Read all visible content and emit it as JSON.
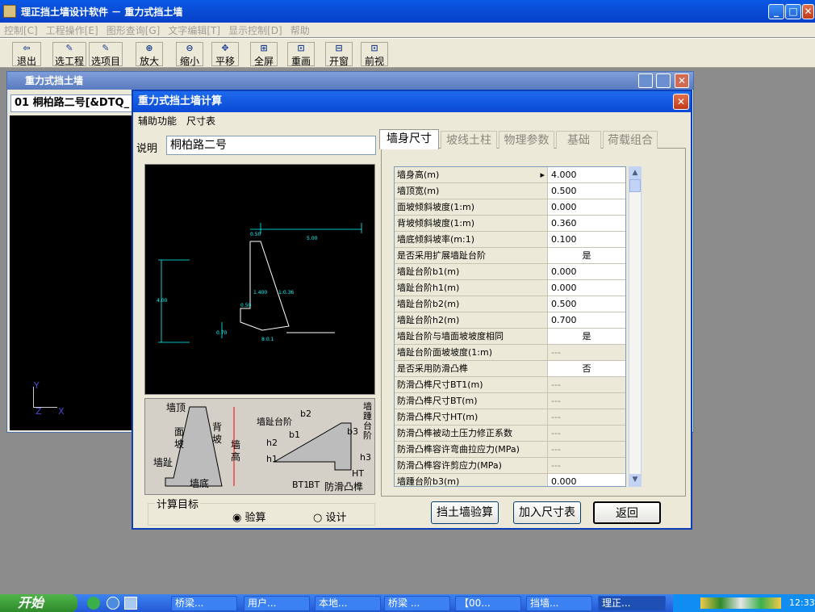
{
  "app": {
    "title": "理正挡土墙设计软件 － 重力式挡土墙",
    "controls": {
      "min": "_",
      "max": "□",
      "close": "✕"
    }
  },
  "menu": [
    "控制[C]",
    "工程操作[E]",
    "图形查询[G]",
    "文字编辑[T]",
    "显示控制[D]",
    "帮助"
  ],
  "toolbar": [
    "退出",
    "选工程",
    "选项目",
    "放大",
    "缩小",
    "平移",
    "全屏",
    "重画",
    "开窗",
    "前视"
  ],
  "inner_window": {
    "title": "重力式挡土墙",
    "combo": "01 桐柏路二号[&DTQ_",
    "axes": {
      "y": "Y",
      "z": "Z",
      "x": "X"
    }
  },
  "dialog": {
    "title": "重力式挡土墙计算",
    "close": "✕",
    "menu": [
      "辅助功能",
      "尺寸表"
    ],
    "desc_label": "说明",
    "desc_value": "桐柏路二号",
    "cad": {
      "dims": [
        "0.50",
        "5.00",
        "4.00",
        "1.400",
        "0.50",
        "0.70",
        "8:0.1",
        "1:0.36"
      ]
    },
    "sketch": {
      "labels": [
        "墙顶",
        "面坡",
        "背坡",
        "墙高",
        "墙趾",
        "墙底",
        "墙趾台阶",
        "b1",
        "b2",
        "h2",
        "h1",
        "BT1",
        "BT",
        "HT",
        "b3",
        "h3",
        "墙踵台阶",
        "防滑凸榫"
      ]
    },
    "target_group": {
      "label": "计算目标",
      "options": [
        "验算",
        "设计"
      ],
      "selected": "验算"
    },
    "tabs": [
      "墙身尺寸",
      "坡线土柱",
      "物理参数",
      "基础",
      "荷载组合"
    ],
    "active_tab": "墙身尺寸",
    "grid": [
      {
        "k": "墙身高(m)",
        "v": "4.000"
      },
      {
        "k": "墙顶宽(m)",
        "v": "0.500"
      },
      {
        "k": "面坡倾斜坡度(1:m)",
        "v": "0.000"
      },
      {
        "k": "背坡倾斜坡度(1:m)",
        "v": "0.360"
      },
      {
        "k": "墙底倾斜坡率(m:1)",
        "v": "0.100"
      },
      {
        "k": "是否采用扩展墙趾台阶",
        "v": "是",
        "c": true
      },
      {
        "k": "墙趾台阶b1(m)",
        "v": "0.000"
      },
      {
        "k": "墙趾台阶h1(m)",
        "v": "0.000"
      },
      {
        "k": "墙趾台阶b2(m)",
        "v": "0.500"
      },
      {
        "k": "墙趾台阶h2(m)",
        "v": "0.700"
      },
      {
        "k": "墙趾台阶与墙面坡坡度相同",
        "v": "是",
        "c": true
      },
      {
        "k": "墙趾台阶面坡坡度(1:m)",
        "v": "---",
        "d": true
      },
      {
        "k": "是否采用防滑凸榫",
        "v": "否",
        "c": true
      },
      {
        "k": "防滑凸榫尺寸BT1(m)",
        "v": "---",
        "d": true
      },
      {
        "k": "防滑凸榫尺寸BT(m)",
        "v": "---",
        "d": true
      },
      {
        "k": "防滑凸榫尺寸HT(m)",
        "v": "---",
        "d": true
      },
      {
        "k": "防滑凸榫被动土压力修正系数",
        "v": "---",
        "d": true
      },
      {
        "k": "防滑凸榫容许弯曲拉应力(MPa)",
        "v": "---",
        "d": true
      },
      {
        "k": "防滑凸榫容许剪应力(MPa)",
        "v": "---",
        "d": true
      },
      {
        "k": "墙踵台阶b3(m)",
        "v": "0.000"
      }
    ],
    "buttons": [
      "挡土墙验算",
      "加入尺寸表",
      "返回"
    ]
  },
  "taskbar": {
    "start": "开始",
    "tasks": [
      "桥梁...",
      "用户...",
      "本地...",
      "桥梁 ...",
      "【00...",
      "挡墙...",
      "理正..."
    ],
    "clock": "12:33"
  }
}
